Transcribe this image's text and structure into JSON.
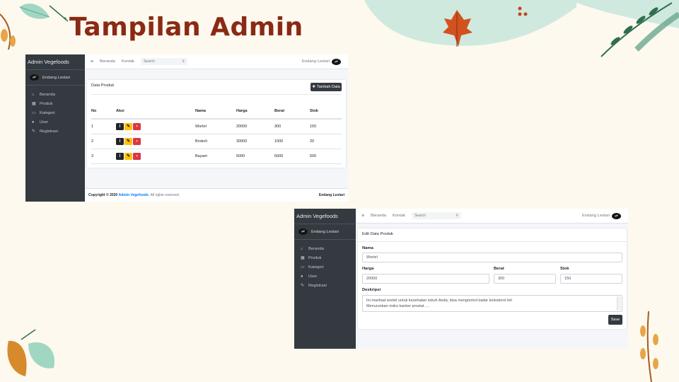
{
  "slide": {
    "title": "Tampilan Admin"
  },
  "window1": {
    "brand": "Admin Vegefoods",
    "user": "Endang Lestari",
    "nav": [
      {
        "label": "Beranda",
        "icon": "home-icon"
      },
      {
        "label": "Produk",
        "icon": "calendar-icon"
      },
      {
        "label": "Kategori",
        "icon": "image-icon"
      },
      {
        "label": "User",
        "icon": "user-icon"
      },
      {
        "label": "Registrasi",
        "icon": "edit-icon"
      }
    ],
    "topbar": {
      "links": [
        "Beranda",
        "Kontak"
      ],
      "search_placeholder": "Search",
      "user": "Endang Lestari"
    },
    "card_title": "Data Produk",
    "add_button": "Tambah Data",
    "table": {
      "headers": [
        "No",
        "Aksi",
        "Nama",
        "Harga",
        "Berat",
        "Stok"
      ],
      "rows": [
        [
          "1",
          "",
          "Wortel",
          "20000",
          "300",
          "150"
        ],
        [
          "2",
          "",
          "Brokoli",
          "30000",
          "1000",
          "20"
        ],
        [
          "3",
          "",
          "Bayam",
          "5000",
          "5000",
          "500"
        ]
      ]
    },
    "footer": {
      "copyright": "Copyright © 2020",
      "brand": "Admin Vegefoods.",
      "rights": "All rights reserved.",
      "user": "Endang Lestari"
    }
  },
  "window2": {
    "brand": "Admin Vegefoods",
    "user": "Endang Lestari",
    "nav": [
      {
        "label": "Beranda",
        "icon": "home-icon"
      },
      {
        "label": "Produk",
        "icon": "calendar-icon"
      },
      {
        "label": "Kategori",
        "icon": "image-icon"
      },
      {
        "label": "User",
        "icon": "user-icon"
      },
      {
        "label": "Registrasi",
        "icon": "edit-icon"
      }
    ],
    "topbar": {
      "links": [
        "Beranda",
        "Kontak"
      ],
      "search_placeholder": "Search",
      "user": "Endang Lestari"
    },
    "card_title": "Edit Data Produk",
    "form": {
      "nama_label": "Nama",
      "nama_value": "Wortel",
      "harga_label": "Harga",
      "harga_value": "20000",
      "berat_label": "Berat",
      "berat_value": "300",
      "stok_label": "Stok",
      "stok_value": "150",
      "deskripsi_label": "Deskripsi",
      "deskripsi_line1": "Ini manfaat wortel untuk kesehatan tubuh Anda, bisa mengontrol kadar kolesterol loh",
      "deskripsi_line2": "Menurunkan risiko kanker prostat. ..."
    },
    "save_button": "Save"
  },
  "colors": {
    "sidebar": "#343a40",
    "title": "#8a2a14",
    "background": "#fdf9ef",
    "accent_link": "#007bff"
  }
}
